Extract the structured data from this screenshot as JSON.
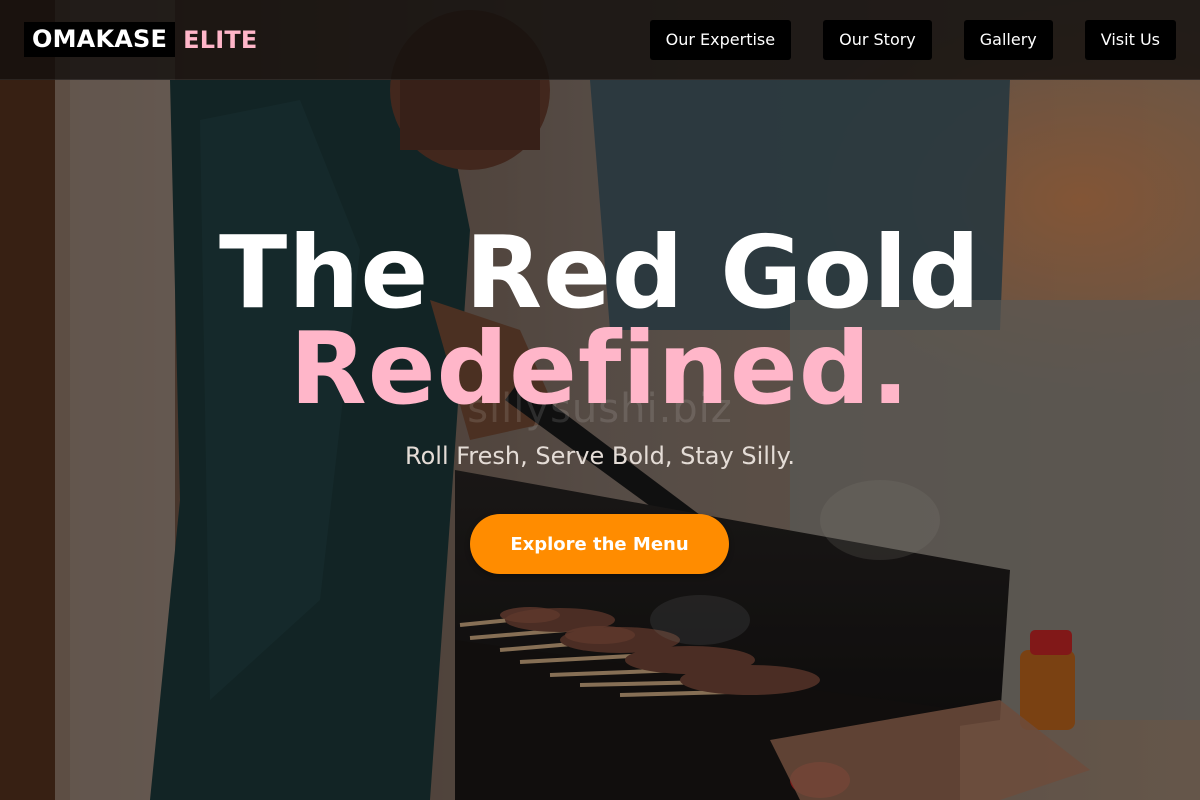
{
  "brand": {
    "name": "OMAKASE",
    "accent": "ELITE"
  },
  "nav": {
    "items": [
      {
        "label": "Our Expertise"
      },
      {
        "label": "Our Story"
      },
      {
        "label": "Gallery"
      },
      {
        "label": "Visit Us"
      }
    ]
  },
  "hero": {
    "title_line1": "The Red Gold",
    "title_line2": "Redefined.",
    "watermark": "sillysushi.biz",
    "subtitle": "Roll Fresh, Serve Bold, Stay Silly.",
    "cta_label": "Explore the Menu",
    "background_image": "chef grilling yakitori skewers over charcoal grill"
  },
  "colors": {
    "accent_pink": "#ffb6c9",
    "cta_orange": "#ff8c00",
    "nav_bg": "#000000",
    "text_white": "#ffffff"
  }
}
